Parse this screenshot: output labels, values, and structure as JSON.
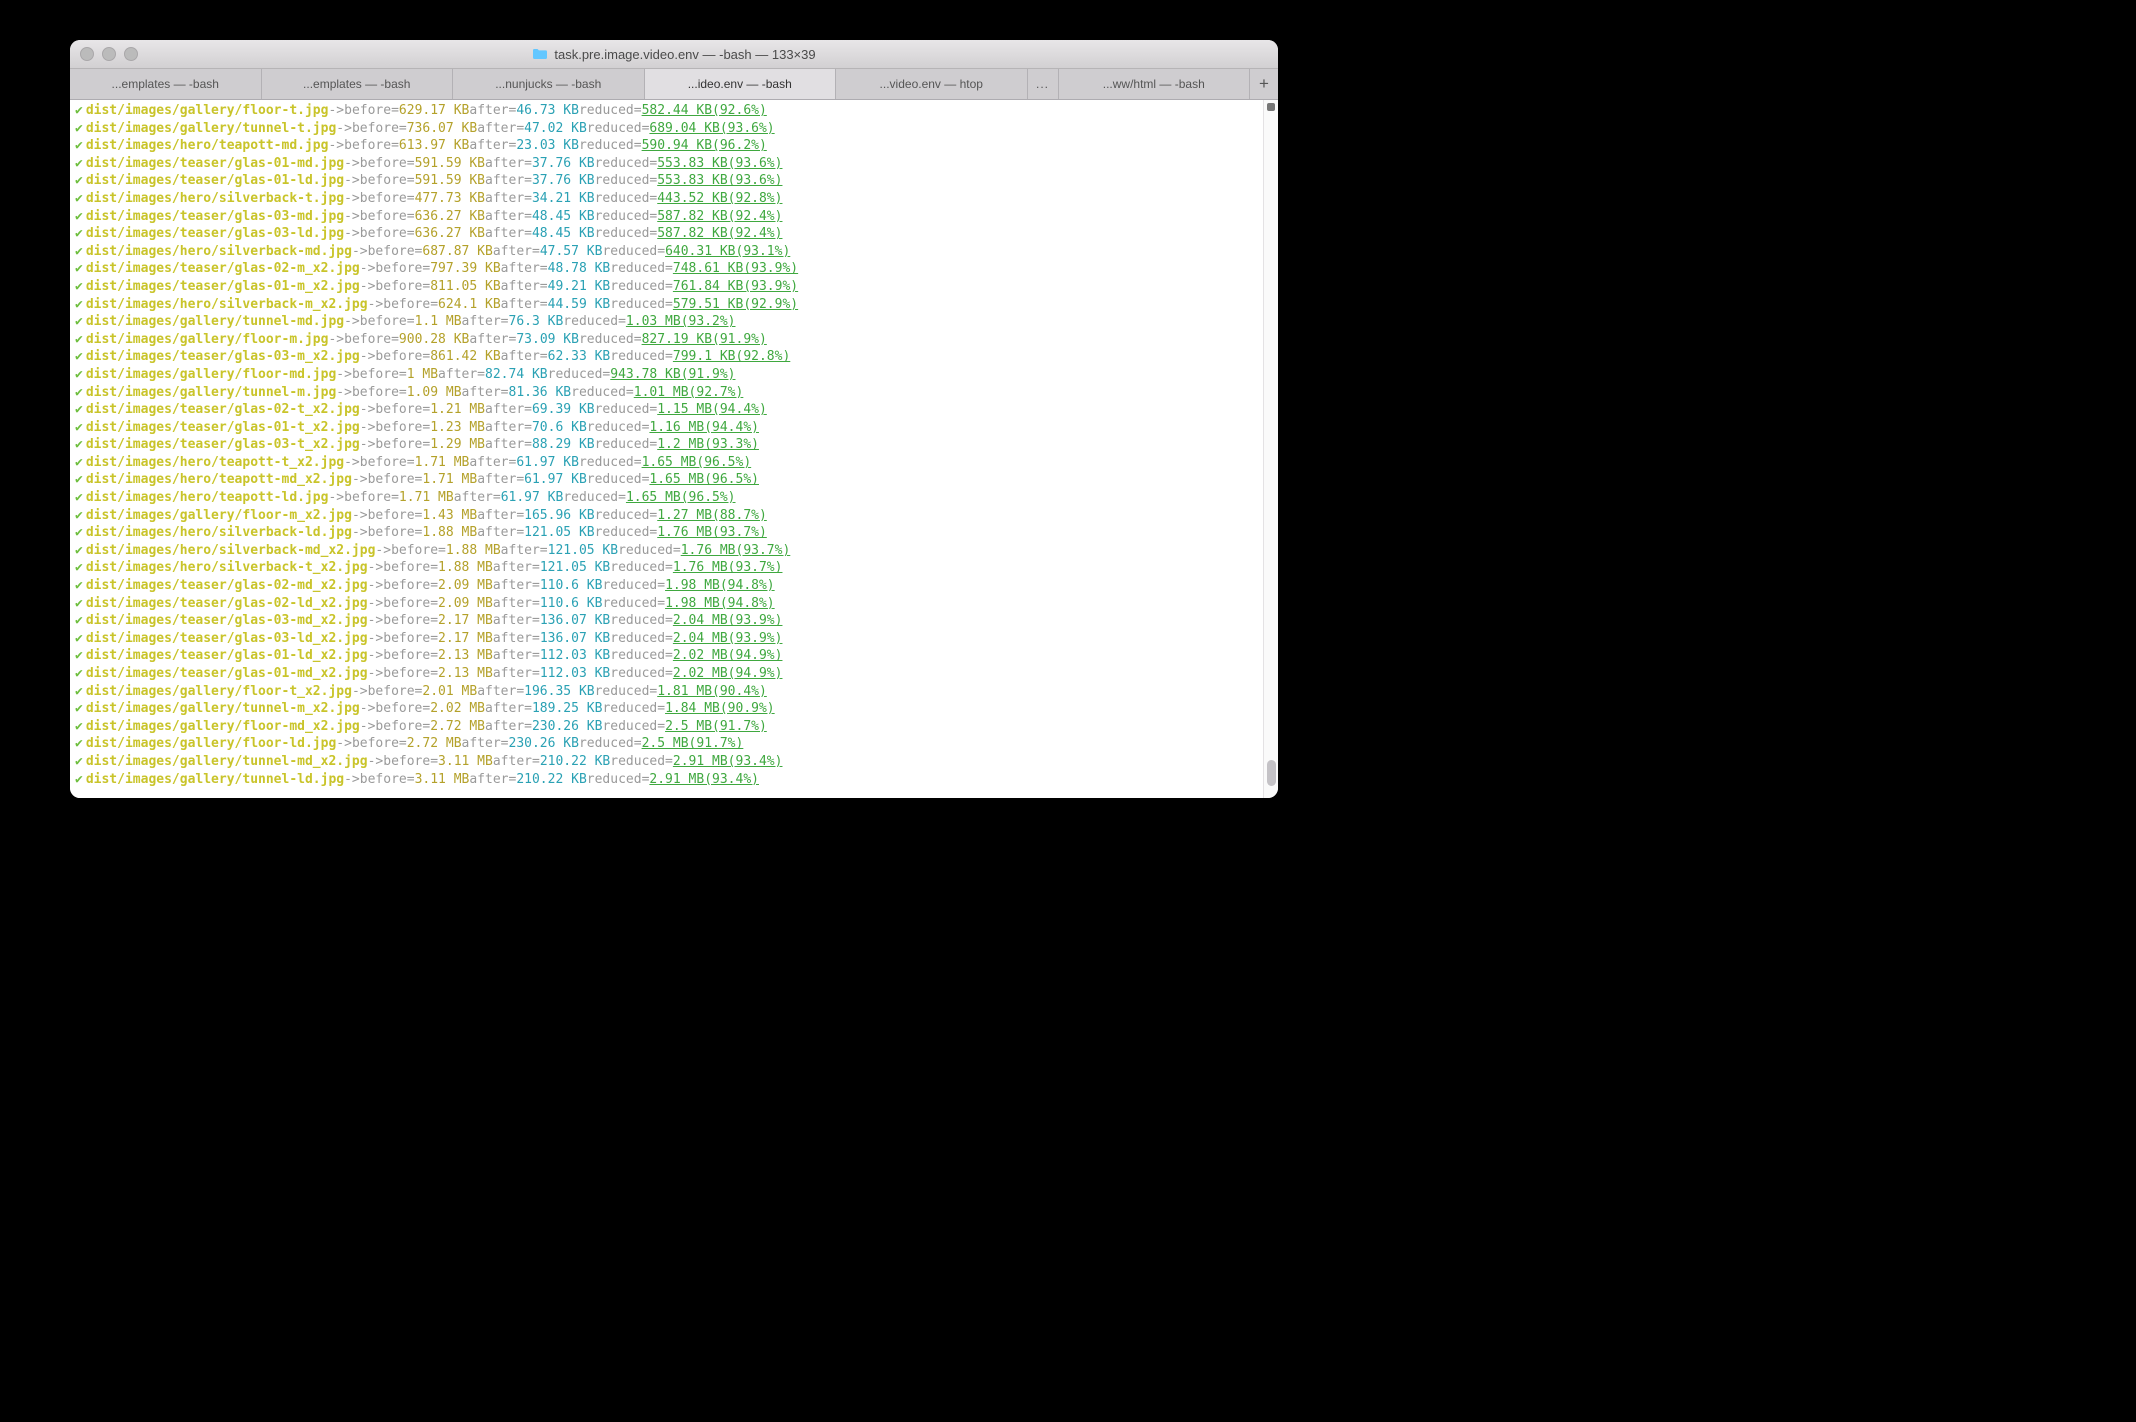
{
  "window": {
    "title": "task.pre.image.video.env — -bash — 133×39"
  },
  "tabs": [
    {
      "label": "...emplates — -bash",
      "active": false
    },
    {
      "label": "...emplates — -bash",
      "active": false
    },
    {
      "label": "...nunjucks — -bash",
      "active": false
    },
    {
      "label": "...ideo.env — -bash",
      "active": true
    },
    {
      "label": "...video.env — htop",
      "active": false
    },
    {
      "label": "...ww/html — -bash",
      "active": false
    }
  ],
  "overflow_label": "...",
  "plus_label": "+",
  "lines": [
    {
      "path": "dist/images/gallery/floor-t.jpg",
      "before": "629.17 KB",
      "after": "46.73 KB",
      "reduced": "582.44 KB(92.6%)"
    },
    {
      "path": "dist/images/gallery/tunnel-t.jpg",
      "before": "736.07 KB",
      "after": "47.02 KB",
      "reduced": "689.04 KB(93.6%)"
    },
    {
      "path": "dist/images/hero/teapott-md.jpg",
      "before": "613.97 KB",
      "after": "23.03 KB",
      "reduced": "590.94 KB(96.2%)"
    },
    {
      "path": "dist/images/teaser/glas-01-md.jpg",
      "before": "591.59 KB",
      "after": "37.76 KB",
      "reduced": "553.83 KB(93.6%)"
    },
    {
      "path": "dist/images/teaser/glas-01-ld.jpg",
      "before": "591.59 KB",
      "after": "37.76 KB",
      "reduced": "553.83 KB(93.6%)"
    },
    {
      "path": "dist/images/hero/silverback-t.jpg",
      "before": "477.73 KB",
      "after": "34.21 KB",
      "reduced": "443.52 KB(92.8%)"
    },
    {
      "path": "dist/images/teaser/glas-03-md.jpg",
      "before": "636.27 KB",
      "after": "48.45 KB",
      "reduced": "587.82 KB(92.4%)"
    },
    {
      "path": "dist/images/teaser/glas-03-ld.jpg",
      "before": "636.27 KB",
      "after": "48.45 KB",
      "reduced": "587.82 KB(92.4%)"
    },
    {
      "path": "dist/images/hero/silverback-md.jpg",
      "before": "687.87 KB",
      "after": "47.57 KB",
      "reduced": "640.31 KB(93.1%)"
    },
    {
      "path": "dist/images/teaser/glas-02-m_x2.jpg",
      "before": "797.39 KB",
      "after": "48.78 KB",
      "reduced": "748.61 KB(93.9%)"
    },
    {
      "path": "dist/images/teaser/glas-01-m_x2.jpg",
      "before": "811.05 KB",
      "after": "49.21 KB",
      "reduced": "761.84 KB(93.9%)"
    },
    {
      "path": "dist/images/hero/silverback-m_x2.jpg",
      "before": "624.1 KB",
      "after": "44.59 KB",
      "reduced": "579.51 KB(92.9%)"
    },
    {
      "path": "dist/images/gallery/tunnel-md.jpg",
      "before": "1.1 MB",
      "after": "76.3 KB",
      "reduced": "1.03 MB(93.2%)"
    },
    {
      "path": "dist/images/gallery/floor-m.jpg",
      "before": "900.28 KB",
      "after": "73.09 KB",
      "reduced": "827.19 KB(91.9%)"
    },
    {
      "path": "dist/images/teaser/glas-03-m_x2.jpg",
      "before": "861.42 KB",
      "after": "62.33 KB",
      "reduced": "799.1 KB(92.8%)"
    },
    {
      "path": "dist/images/gallery/floor-md.jpg",
      "before": "1 MB",
      "after": "82.74 KB",
      "reduced": "943.78 KB(91.9%)"
    },
    {
      "path": "dist/images/gallery/tunnel-m.jpg",
      "before": "1.09 MB",
      "after": "81.36 KB",
      "reduced": "1.01 MB(92.7%)"
    },
    {
      "path": "dist/images/teaser/glas-02-t_x2.jpg",
      "before": "1.21 MB",
      "after": "69.39 KB",
      "reduced": "1.15 MB(94.4%)"
    },
    {
      "path": "dist/images/teaser/glas-01-t_x2.jpg",
      "before": "1.23 MB",
      "after": "70.6 KB",
      "reduced": "1.16 MB(94.4%)"
    },
    {
      "path": "dist/images/teaser/glas-03-t_x2.jpg",
      "before": "1.29 MB",
      "after": "88.29 KB",
      "reduced": "1.2 MB(93.3%)"
    },
    {
      "path": "dist/images/hero/teapott-t_x2.jpg",
      "before": "1.71 MB",
      "after": "61.97 KB",
      "reduced": "1.65 MB(96.5%)"
    },
    {
      "path": "dist/images/hero/teapott-md_x2.jpg",
      "before": "1.71 MB",
      "after": "61.97 KB",
      "reduced": "1.65 MB(96.5%)"
    },
    {
      "path": "dist/images/hero/teapott-ld.jpg",
      "before": "1.71 MB",
      "after": "61.97 KB",
      "reduced": "1.65 MB(96.5%)"
    },
    {
      "path": "dist/images/gallery/floor-m_x2.jpg",
      "before": "1.43 MB",
      "after": "165.96 KB",
      "reduced": "1.27 MB(88.7%)"
    },
    {
      "path": "dist/images/hero/silverback-ld.jpg",
      "before": "1.88 MB",
      "after": "121.05 KB",
      "reduced": "1.76 MB(93.7%)"
    },
    {
      "path": "dist/images/hero/silverback-md_x2.jpg",
      "before": "1.88 MB",
      "after": "121.05 KB",
      "reduced": "1.76 MB(93.7%)"
    },
    {
      "path": "dist/images/hero/silverback-t_x2.jpg",
      "before": "1.88 MB",
      "after": "121.05 KB",
      "reduced": "1.76 MB(93.7%)"
    },
    {
      "path": "dist/images/teaser/glas-02-md_x2.jpg",
      "before": "2.09 MB",
      "after": "110.6 KB",
      "reduced": "1.98 MB(94.8%)"
    },
    {
      "path": "dist/images/teaser/glas-02-ld_x2.jpg",
      "before": "2.09 MB",
      "after": "110.6 KB",
      "reduced": "1.98 MB(94.8%)"
    },
    {
      "path": "dist/images/teaser/glas-03-md_x2.jpg",
      "before": "2.17 MB",
      "after": "136.07 KB",
      "reduced": "2.04 MB(93.9%)"
    },
    {
      "path": "dist/images/teaser/glas-03-ld_x2.jpg",
      "before": "2.17 MB",
      "after": "136.07 KB",
      "reduced": "2.04 MB(93.9%)"
    },
    {
      "path": "dist/images/teaser/glas-01-ld_x2.jpg",
      "before": "2.13 MB",
      "after": "112.03 KB",
      "reduced": "2.02 MB(94.9%)"
    },
    {
      "path": "dist/images/teaser/glas-01-md_x2.jpg",
      "before": "2.13 MB",
      "after": "112.03 KB",
      "reduced": "2.02 MB(94.9%)"
    },
    {
      "path": "dist/images/gallery/floor-t_x2.jpg",
      "before": "2.01 MB",
      "after": "196.35 KB",
      "reduced": "1.81 MB(90.4%)"
    },
    {
      "path": "dist/images/gallery/tunnel-m_x2.jpg",
      "before": "2.02 MB",
      "after": "189.25 KB",
      "reduced": "1.84 MB(90.9%)"
    },
    {
      "path": "dist/images/gallery/floor-md_x2.jpg",
      "before": "2.72 MB",
      "after": "230.26 KB",
      "reduced": "2.5 MB(91.7%)"
    },
    {
      "path": "dist/images/gallery/floor-ld.jpg",
      "before": "2.72 MB",
      "after": "230.26 KB",
      "reduced": "2.5 MB(91.7%)"
    },
    {
      "path": "dist/images/gallery/tunnel-md_x2.jpg",
      "before": "3.11 MB",
      "after": "210.22 KB",
      "reduced": "2.91 MB(93.4%)"
    },
    {
      "path": "dist/images/gallery/tunnel-ld.jpg",
      "before": "3.11 MB",
      "after": "210.22 KB",
      "reduced": "2.91 MB(93.4%)"
    }
  ],
  "tokens": {
    "check": "✔",
    "arrow": "->",
    "before": "before=",
    "after": "after=",
    "reduced": "reduced="
  }
}
